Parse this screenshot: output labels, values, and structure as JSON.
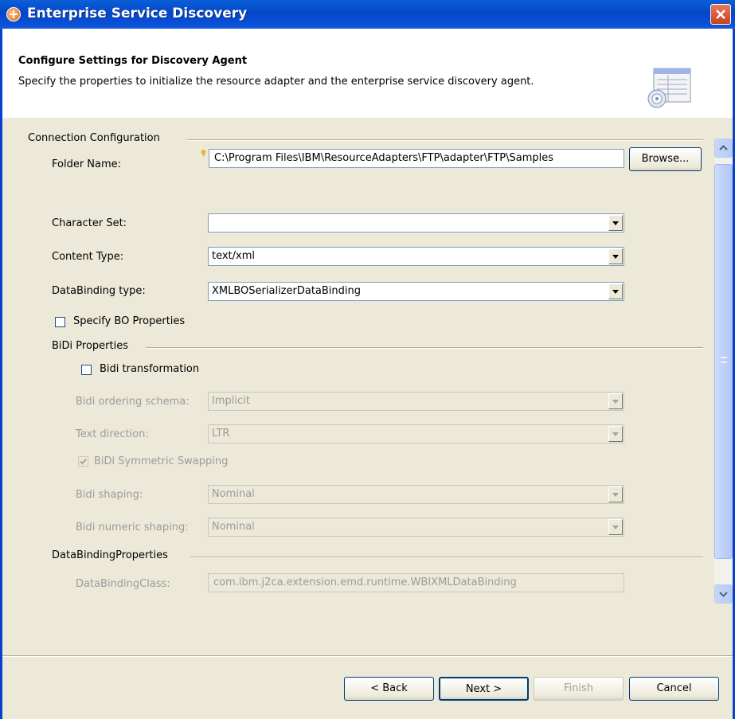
{
  "window": {
    "title": "Enterprise Service Discovery"
  },
  "header": {
    "title": "Configure Settings for Discovery Agent",
    "description": "Specify the properties to initialize the resource adapter and the enterprise service discovery agent."
  },
  "connection": {
    "group_label": "Connection Configuration",
    "folder_label": "Folder Name:",
    "folder_value": "C:\\Program Files\\IBM\\ResourceAdapters\\FTP\\adapter\\FTP\\Samples",
    "browse_label": "Browse...",
    "charset_label": "Character Set:",
    "charset_value": "",
    "content_type_label": "Content Type:",
    "content_type_value": "text/xml",
    "databinding_label": "DataBinding type:",
    "databinding_value": "XMLBOSerializerDataBinding",
    "specify_bo_label": "Specify BO Properties",
    "specify_bo_checked": false
  },
  "bidi": {
    "group_label": "BiDi Properties",
    "transformation_label": "Bidi transformation",
    "transformation_checked": false,
    "ordering_label": "Bidi ordering schema:",
    "ordering_value": "Implicit",
    "text_direction_label": "Text direction:",
    "text_direction_value": "LTR",
    "symmetric_label": "BiDi Symmetric Swapping",
    "symmetric_checked": true,
    "shaping_label": "Bidi shaping:",
    "shaping_value": "Nominal",
    "numeric_label": "Bidi numeric shaping:",
    "numeric_value": "Nominal"
  },
  "databinding_props": {
    "group_label": "DataBindingProperties",
    "class_label": "DataBindingClass:",
    "class_value": "com.ibm.j2ca.extension.emd.runtime.WBIXMLDataBinding"
  },
  "footer": {
    "back_label": "< Back",
    "next_label": "Next >",
    "finish_label": "Finish",
    "cancel_label": "Cancel"
  },
  "colors": {
    "titlebar": "#0a52dc",
    "dialog_bg": "#ece9d8",
    "close": "#c8421c"
  },
  "icons": [
    "app-icon",
    "close-icon",
    "wizard-banner-icon",
    "required-field-icon",
    "dropdown-arrow-icon",
    "checkbox-check-icon",
    "scroll-up-icon",
    "scroll-down-icon"
  ]
}
